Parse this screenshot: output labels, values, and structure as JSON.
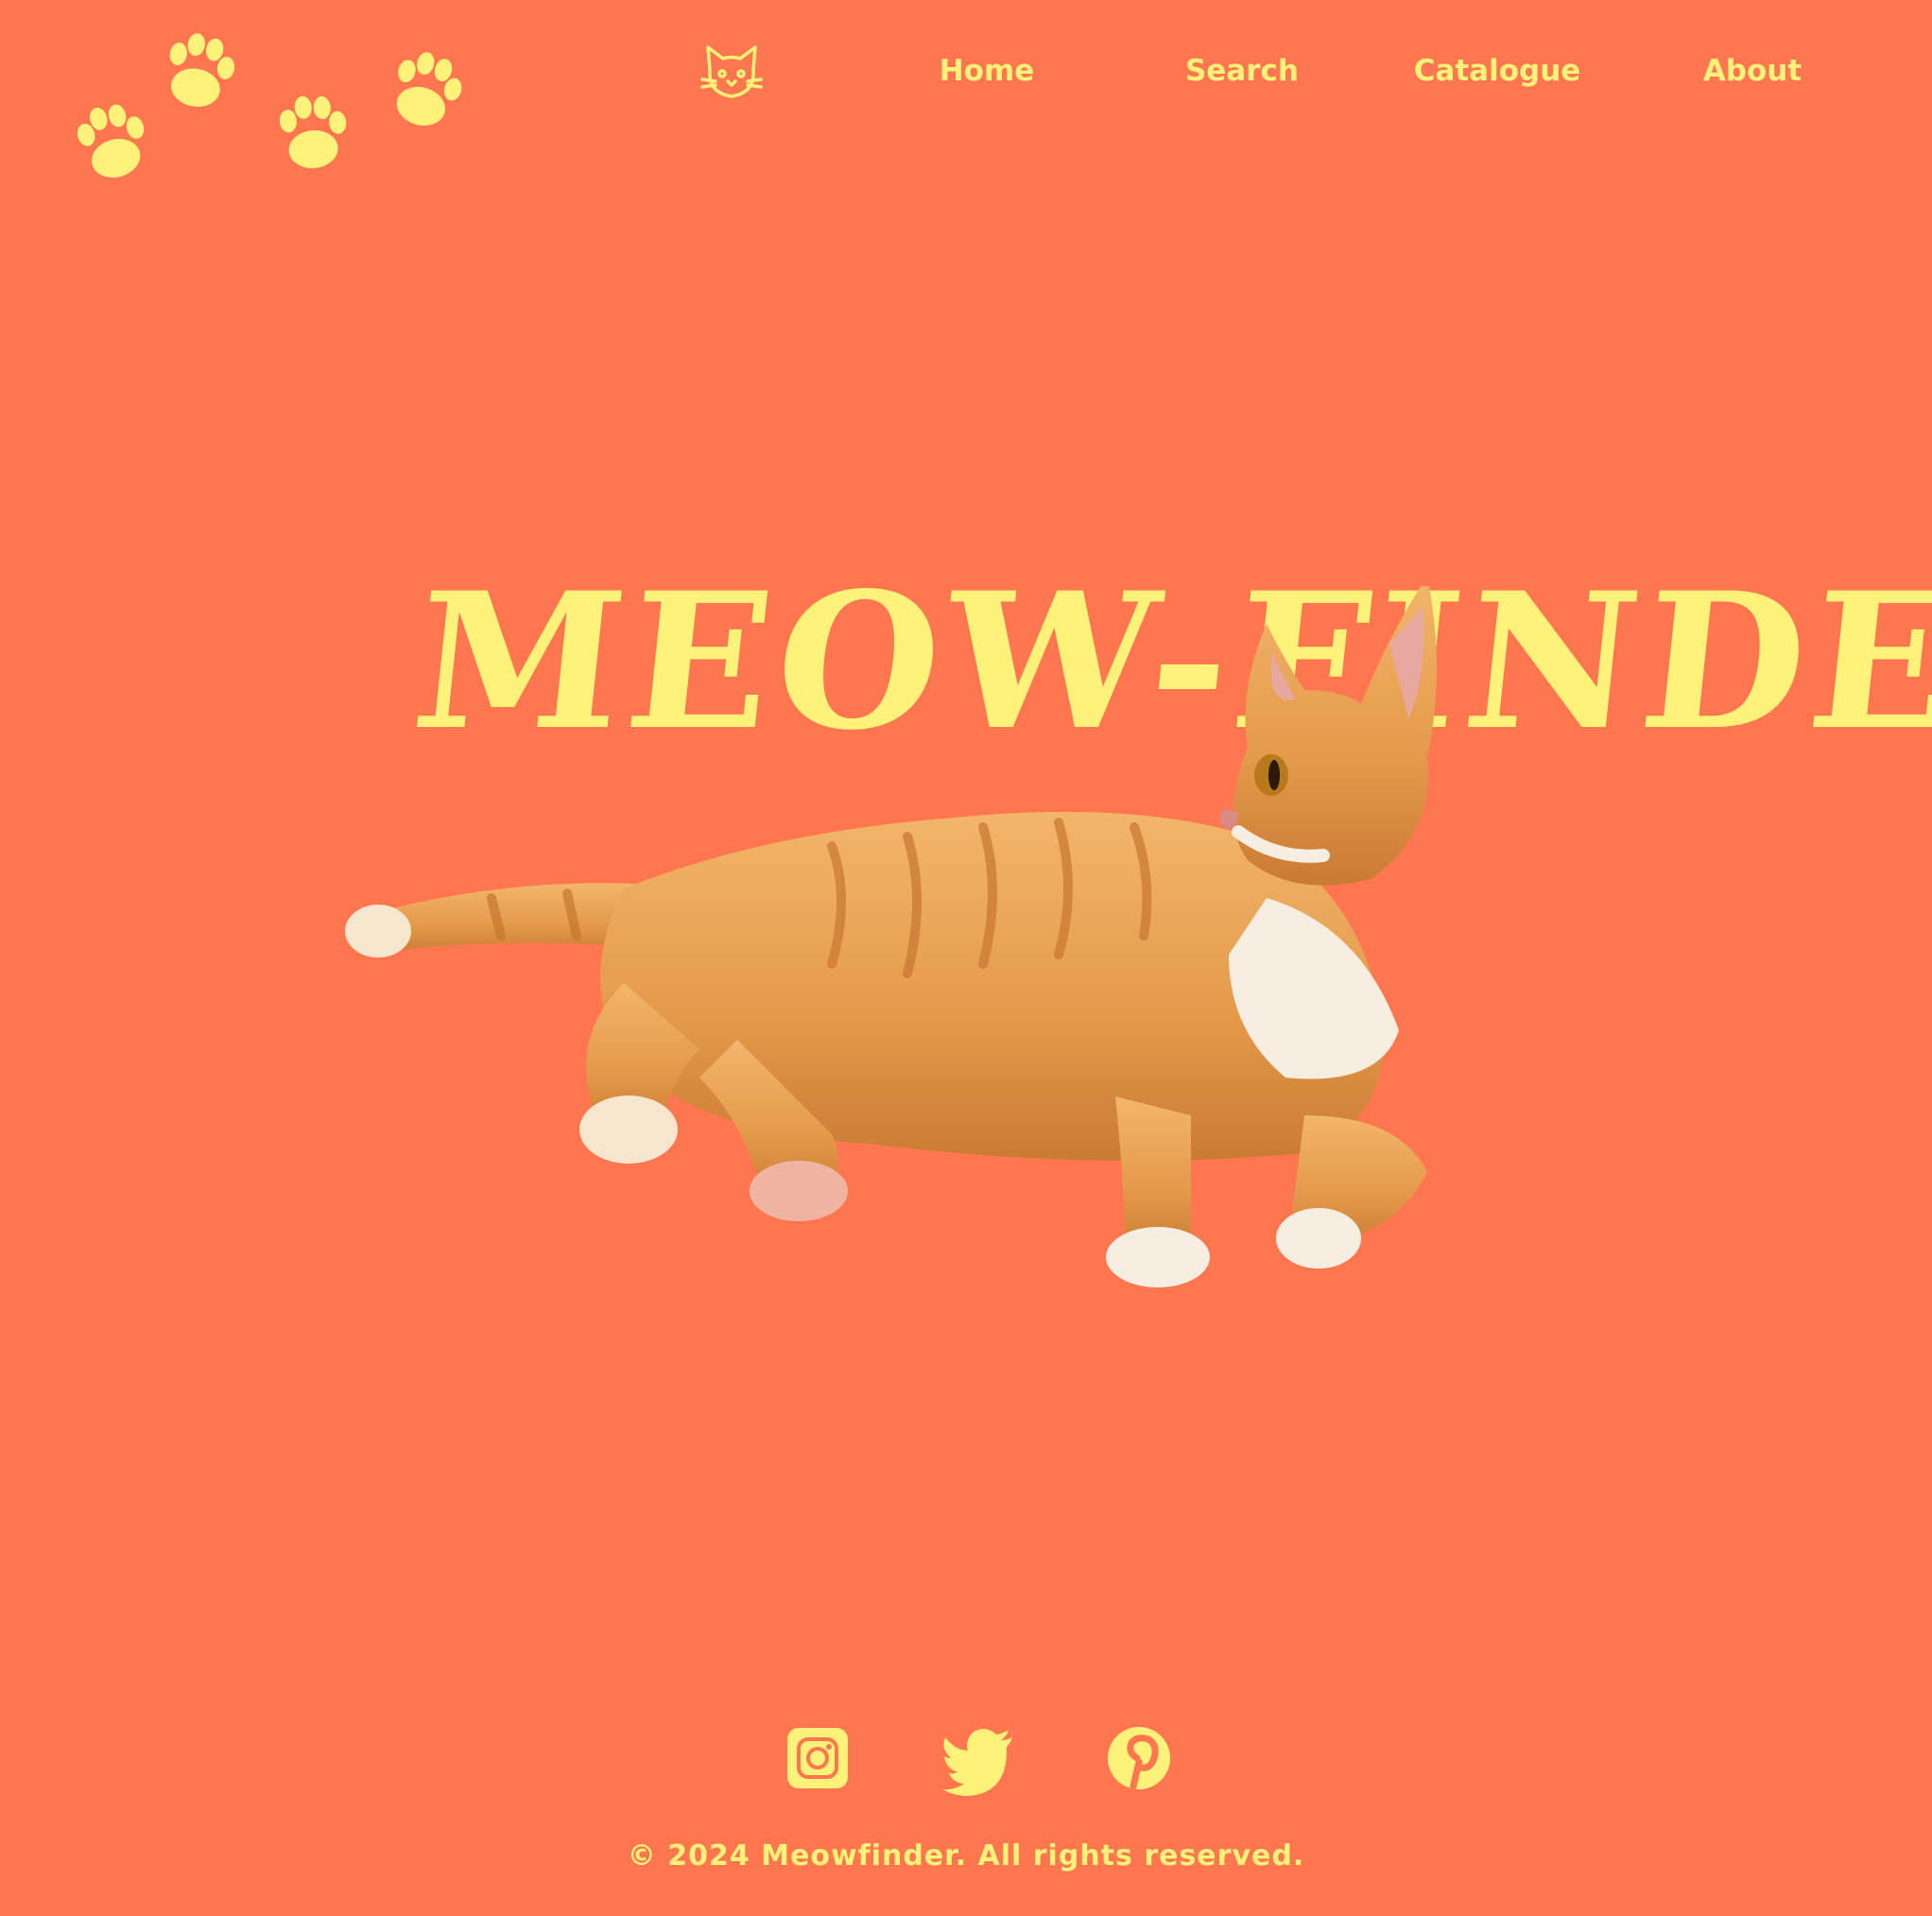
{
  "colors": {
    "background": "#FF764F",
    "accent": "#FFF27A"
  },
  "decor": {
    "paws_icon": "paw-prints-icon"
  },
  "nav": {
    "logo_icon": "cat-face-icon",
    "items": [
      {
        "label": "Home"
      },
      {
        "label": "Search"
      },
      {
        "label": "Catalogue"
      },
      {
        "label": "About"
      }
    ]
  },
  "hero": {
    "title": "MEOW-FINDER",
    "image": "orange-tabby-cat-lying"
  },
  "footer": {
    "social": [
      {
        "icon": "instagram-icon"
      },
      {
        "icon": "twitter-icon"
      },
      {
        "icon": "pinterest-icon"
      }
    ],
    "copyright": "© 2024 Meowfinder. All rights reserved."
  }
}
